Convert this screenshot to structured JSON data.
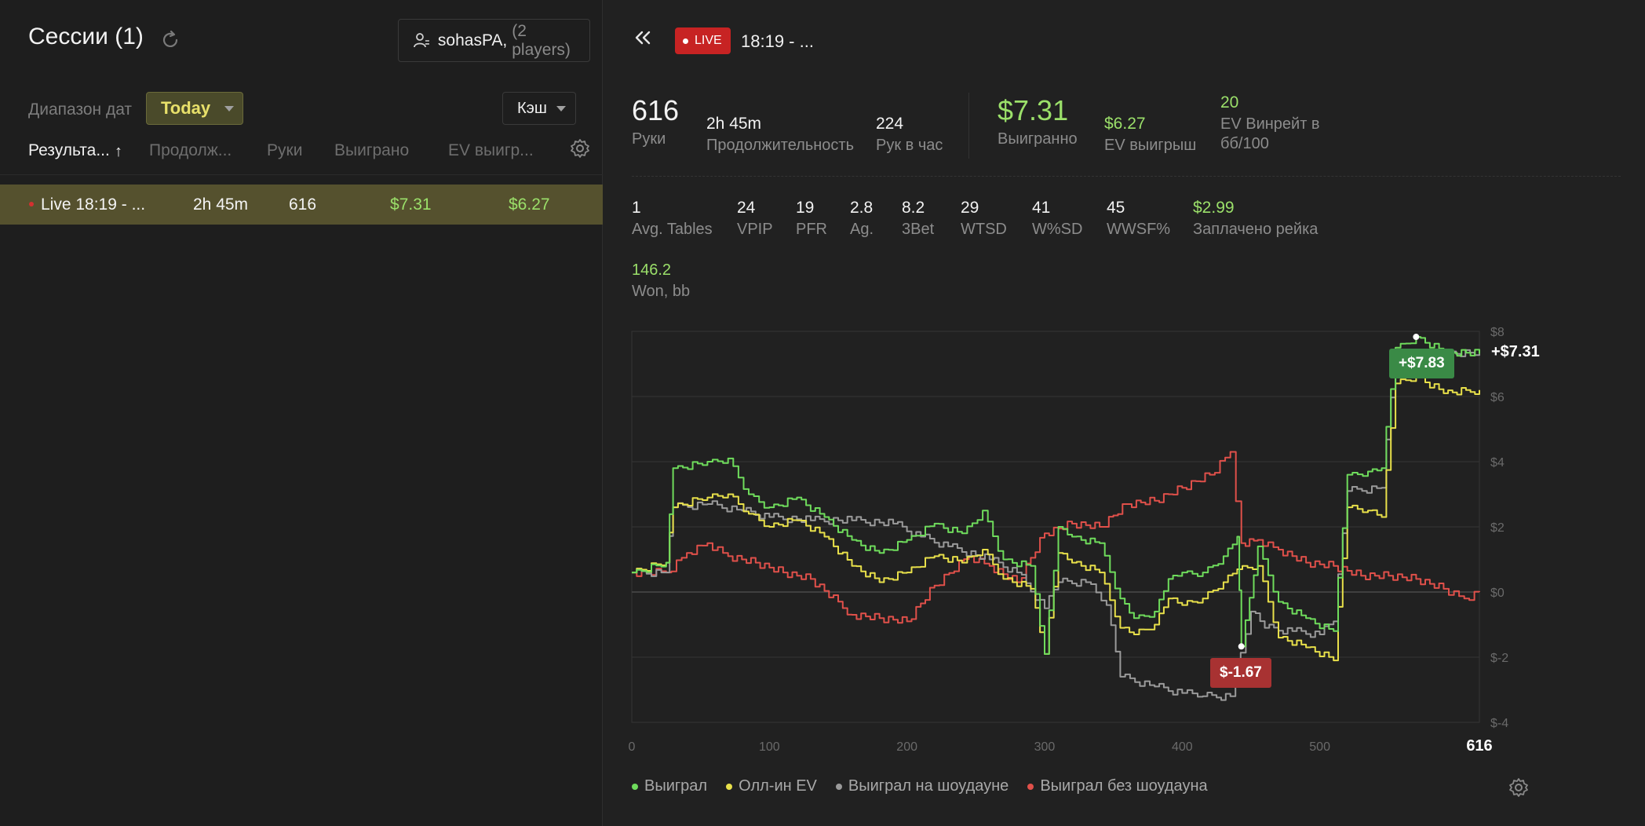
{
  "left": {
    "title": "Сессии (1)",
    "player": {
      "name": "sohasPA,",
      "count": "(2 players)"
    },
    "date_range": {
      "label": "Диапазон дат",
      "value": "Today"
    },
    "game_type": "Кэш",
    "columns": [
      "Результа...",
      "Продолж...",
      "Руки",
      "Выиграно",
      "EV выигр..."
    ],
    "sort_indicator": "↑",
    "sessions": [
      {
        "name": "Live 18:19 - ...",
        "duration": "2h 45m",
        "hands": "616",
        "won": "$7.31",
        "ev_won": "$6.27"
      }
    ]
  },
  "right": {
    "live_badge": "LIVE",
    "session_title": "18:19 - ...",
    "summary": {
      "hands": {
        "value": "616",
        "label": "Руки"
      },
      "duration": {
        "value": "2h 45m",
        "label": "Продолжительность"
      },
      "hands_per_hour": {
        "value": "224",
        "label": "Рук в час"
      },
      "won": {
        "value": "$7.31",
        "label": "Выигранно"
      },
      "ev_won": {
        "value": "$6.27",
        "label": "EV выигрыш"
      },
      "ev_winrate": {
        "value": "20",
        "label1": "EV Винрейт в",
        "label2": "бб/100"
      }
    },
    "stats": [
      {
        "value": "1",
        "label": "Avg. Tables"
      },
      {
        "value": "24",
        "label": "VPIP"
      },
      {
        "value": "19",
        "label": "PFR"
      },
      {
        "value": "2.8",
        "label": "Ag."
      },
      {
        "value": "8.2",
        "label": "3Bet"
      },
      {
        "value": "29",
        "label": "WTSD"
      },
      {
        "value": "41",
        "label": "W%SD"
      },
      {
        "value": "45",
        "label": "WWSF%"
      },
      {
        "value": "$2.99",
        "label": "Заплачено рейка"
      }
    ],
    "won_bb": {
      "value": "146.2",
      "label": "Won, bb"
    },
    "chart": {
      "max_tag": "+$7.83",
      "min_tag": "$-1.67",
      "end_label": "+$7.31",
      "x_end_label": "616",
      "legend": [
        {
          "label": "Выиграл",
          "color": "#6fdc5c"
        },
        {
          "label": "Олл-ин EV",
          "color": "#e8e04a"
        },
        {
          "label": "Выиграл на шоудауне",
          "color": "#9a9a9a"
        },
        {
          "label": "Выиграл без шоудауна",
          "color": "#e0504a"
        }
      ]
    }
  },
  "chart_data": {
    "type": "line",
    "title": "",
    "xlabel": "",
    "ylabel": "",
    "xlim": [
      0,
      616
    ],
    "ylim": [
      -4,
      8
    ],
    "x_ticks": [
      0,
      100,
      200,
      300,
      400,
      500,
      616
    ],
    "y_ticks": [
      "$-4",
      "$-2",
      "$0",
      "$2",
      "$4",
      "$6",
      "$8"
    ],
    "y_tick_values": [
      -4,
      -2,
      0,
      2,
      4,
      6,
      8
    ],
    "grid": true,
    "legend_position": "bottom-left",
    "annotations": [
      {
        "text": "+$7.83",
        "x": 570,
        "y": 7.83
      },
      {
        "text": "$-1.67",
        "x": 443,
        "y": -1.67
      },
      {
        "text": "+$7.31",
        "x": 616,
        "y": 7.31
      }
    ],
    "series": [
      {
        "name": "Выиграл",
        "color": "#6fdc5c",
        "x": [
          0,
          25,
          30,
          55,
          70,
          85,
          100,
          120,
          140,
          160,
          180,
          200,
          220,
          240,
          255,
          270,
          290,
          300,
          310,
          320,
          340,
          355,
          365,
          380,
          390,
          400,
          415,
          430,
          440,
          443,
          455,
          470,
          490,
          510,
          520,
          535,
          545,
          555,
          570,
          590,
          616
        ],
        "y": [
          0.6,
          0.9,
          3.8,
          4.0,
          4.1,
          3.0,
          2.6,
          2.9,
          2.3,
          1.6,
          1.2,
          1.6,
          2.1,
          1.8,
          2.5,
          1.0,
          0.8,
          -1.9,
          2.0,
          1.7,
          1.5,
          -0.2,
          -0.8,
          -0.6,
          0.4,
          0.6,
          0.6,
          1.1,
          1.7,
          -1.67,
          1.4,
          -0.3,
          -0.8,
          -1.2,
          3.6,
          3.7,
          3.8,
          7.5,
          7.83,
          7.4,
          7.31
        ]
      },
      {
        "name": "Олл-ин EV",
        "color": "#e8e04a",
        "x": [
          0,
          25,
          30,
          55,
          70,
          85,
          100,
          120,
          140,
          160,
          180,
          200,
          220,
          240,
          255,
          270,
          290,
          300,
          310,
          320,
          340,
          355,
          365,
          380,
          390,
          400,
          415,
          430,
          440,
          455,
          470,
          490,
          510,
          520,
          535,
          545,
          555,
          570,
          590,
          616
        ],
        "y": [
          0.6,
          0.9,
          2.6,
          2.9,
          3.0,
          2.4,
          2.0,
          2.2,
          1.7,
          0.8,
          0.3,
          0.6,
          1.1,
          0.9,
          1.3,
          0.4,
          0.1,
          -1.9,
          1.2,
          0.9,
          0.6,
          -1.1,
          -1.3,
          -1.0,
          -0.2,
          -0.4,
          -0.2,
          0.3,
          0.7,
          0.8,
          -1.4,
          -1.7,
          -2.1,
          2.6,
          2.5,
          2.3,
          6.4,
          6.6,
          6.1,
          6.2
        ]
      },
      {
        "name": "Выиграл на шоудауне",
        "color": "#9a9a9a",
        "x": [
          0,
          25,
          30,
          55,
          80,
          100,
          130,
          160,
          190,
          210,
          230,
          260,
          280,
          300,
          310,
          330,
          345,
          355,
          380,
          400,
          415,
          435,
          450,
          460,
          480,
          500,
          510,
          520,
          545,
          555,
          616
        ],
        "y": [
          0.6,
          0.6,
          2.6,
          2.7,
          2.5,
          2.3,
          2.2,
          2.2,
          2.1,
          1.7,
          1.4,
          1.0,
          0.6,
          -0.5,
          0.3,
          0.3,
          -0.4,
          -2.6,
          -2.9,
          -3.1,
          -3.2,
          -3.2,
          -0.6,
          -1.1,
          -1.2,
          -1.3,
          -0.9,
          3.1,
          3.2,
          7.3,
          7.31
        ]
      },
      {
        "name": "Выиграл без шоудауна",
        "color": "#e0504a",
        "x": [
          0,
          25,
          40,
          55,
          70,
          90,
          110,
          130,
          160,
          180,
          200,
          220,
          245,
          260,
          280,
          300,
          320,
          340,
          360,
          380,
          400,
          420,
          435,
          443,
          455,
          470,
          490,
          510,
          530,
          550,
          570,
          590,
          605,
          616
        ],
        "y": [
          0.6,
          0.6,
          1.2,
          1.5,
          1.1,
          0.9,
          0.6,
          0.4,
          -0.7,
          -0.8,
          -0.9,
          0.2,
          1.1,
          0.8,
          0.3,
          1.8,
          2.1,
          2.0,
          2.7,
          2.8,
          3.2,
          3.6,
          4.3,
          1.5,
          1.6,
          1.3,
          0.9,
          0.8,
          0.5,
          0.5,
          0.4,
          0.1,
          -0.2,
          0.0
        ]
      }
    ]
  }
}
